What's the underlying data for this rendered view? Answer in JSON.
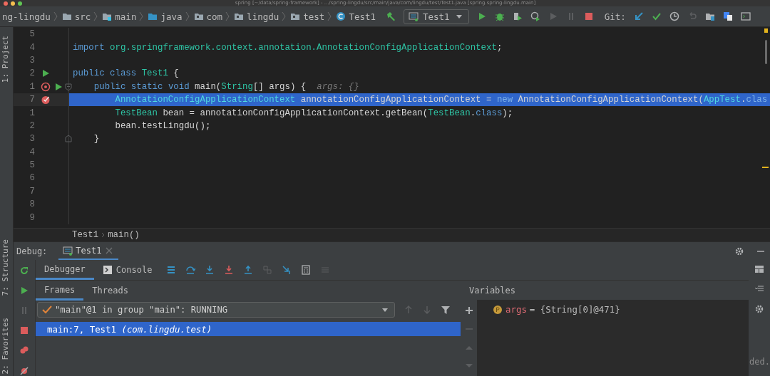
{
  "window": {
    "title": "spring [~/data/spring-framework] - .../spring-lingdu/src/main/java/com/lingdu/test/Test1.java [spring.spring-lingdu.main]"
  },
  "breadcrumbs": [
    {
      "label": "ng-lingdu",
      "kind": "module"
    },
    {
      "label": "src",
      "kind": "folder"
    },
    {
      "label": "main",
      "kind": "source-root"
    },
    {
      "label": "java",
      "kind": "java-root"
    },
    {
      "label": "com",
      "kind": "package"
    },
    {
      "label": "lingdu",
      "kind": "package"
    },
    {
      "label": "test",
      "kind": "package"
    },
    {
      "label": "Test1",
      "kind": "class"
    }
  ],
  "run_config": {
    "label": "Test1"
  },
  "toolbar": [
    {
      "kind": "run",
      "disabled": false
    },
    {
      "kind": "debug",
      "disabled": false
    },
    {
      "kind": "coverage",
      "disabled": false
    },
    {
      "kind": "profile",
      "disabled": false
    },
    {
      "kind": "resume",
      "disabled": true
    },
    {
      "kind": "pause",
      "disabled": true
    },
    {
      "kind": "stop",
      "disabled": false
    }
  ],
  "git": {
    "label": "Git:",
    "actions": [
      {
        "kind": "update",
        "disabled": false
      },
      {
        "kind": "commit",
        "disabled": false
      },
      {
        "kind": "history",
        "disabled": false
      },
      {
        "kind": "rollback",
        "disabled": true
      },
      {
        "kind": "structure",
        "disabled": false
      },
      {
        "kind": "translate",
        "disabled": false
      },
      {
        "kind": "terminal",
        "disabled": false
      }
    ]
  },
  "tool_tabs": [
    {
      "label": "1: Project",
      "kind": "top"
    },
    {
      "label": "7: Structure",
      "kind": "bottom"
    },
    {
      "label": "2: Favorites",
      "kind": "bottom"
    }
  ],
  "editor": {
    "lines": [
      {
        "number": "5",
        "current": false
      },
      {
        "number": "4",
        "kind": "top",
        "current": false,
        "tokens": [
          {
            "kind": "kw",
            "text": "import "
          },
          {
            "kind": "type",
            "text": "org.springframework.context.annotation.AnnotationConfigApplicationContext"
          },
          {
            "kind": "plain",
            "text": ";"
          }
        ]
      },
      {
        "number": "3",
        "current": false
      },
      {
        "number": "2",
        "kind": "top",
        "current": false,
        "markers": [
          {
            "kind": "run"
          }
        ],
        "tokens": [
          {
            "kind": "kw",
            "text": "public class "
          },
          {
            "kind": "type",
            "text": "Test1"
          },
          {
            "kind": "plain",
            "text": " {"
          }
        ]
      },
      {
        "number": "1",
        "kind": "member",
        "current": false,
        "markers": [
          {
            "kind": "method-breakpoint"
          },
          {
            "kind": "run"
          },
          {
            "kind": "fold-start"
          }
        ],
        "tokens": [
          {
            "kind": "kw",
            "text": "public static void"
          },
          {
            "kind": "plain",
            "text": " main("
          },
          {
            "kind": "type",
            "text": "String"
          },
          {
            "kind": "plain",
            "text": "[] args) {"
          },
          {
            "kind": "hint",
            "text": "args: {}"
          }
        ]
      },
      {
        "number": "7",
        "kind": "body",
        "current": true,
        "markers": [
          {
            "kind": "breakpoint"
          }
        ],
        "tokens": [
          {
            "kind": "type",
            "text": "AnnotationConfigApplicationContext"
          },
          {
            "kind": "plain",
            "text": " annotationConfigApplicationContext = "
          },
          {
            "kind": "kw",
            "text": "new"
          },
          {
            "kind": "plain",
            "text": " AnnotationConfigApplicationContext("
          },
          {
            "kind": "type",
            "text": "AppTest"
          },
          {
            "kind": "plain",
            "text": "."
          },
          {
            "kind": "kw",
            "text": "clas"
          }
        ]
      },
      {
        "number": "1",
        "kind": "body",
        "current": false,
        "tokens": [
          {
            "kind": "type",
            "text": "TestBean"
          },
          {
            "kind": "plain",
            "text": " bean = annotationConfigApplicationContext.getBean("
          },
          {
            "kind": "type",
            "text": "TestBean"
          },
          {
            "kind": "plain",
            "text": "."
          },
          {
            "kind": "kw",
            "text": "class"
          },
          {
            "kind": "plain",
            "text": ");"
          }
        ]
      },
      {
        "number": "2",
        "kind": "body",
        "current": false,
        "tokens": [
          {
            "kind": "plain",
            "text": "bean.testLingdu();"
          }
        ]
      },
      {
        "number": "3",
        "kind": "member",
        "current": false,
        "markers": [
          {
            "kind": "fold-end"
          }
        ],
        "tokens": [
          {
            "kind": "plain",
            "text": "}"
          }
        ]
      },
      {
        "number": "4",
        "current": false
      },
      {
        "number": "5",
        "current": false
      },
      {
        "number": "6",
        "current": false
      },
      {
        "number": "7",
        "current": false
      },
      {
        "number": "8",
        "current": false
      },
      {
        "number": "9",
        "current": false
      }
    ],
    "breadcrumb": [
      "Test1",
      "main()"
    ]
  },
  "debug": {
    "label": "Debug:",
    "session_tabs": [
      {
        "label": "Test1",
        "selected": true
      }
    ],
    "side_actions": [
      {
        "kind": "rerun",
        "disabled": false
      },
      {
        "kind": "resume",
        "disabled": false
      },
      {
        "kind": "pause",
        "disabled": true
      },
      {
        "kind": "stop",
        "disabled": false
      },
      {
        "kind": "breakpoints",
        "disabled": false
      },
      {
        "kind": "mute",
        "disabled": false
      }
    ],
    "tabs": [
      {
        "label": "Debugger",
        "kind": "debugger",
        "selected": true
      },
      {
        "label": "Console",
        "kind": "console",
        "selected": false
      }
    ],
    "step_actions": [
      {
        "kind": "menu",
        "disabled": false
      },
      {
        "kind": "step-over",
        "disabled": false
      },
      {
        "kind": "step-into",
        "disabled": false
      },
      {
        "kind": "force-step-into",
        "disabled": false
      },
      {
        "kind": "step-out",
        "disabled": false
      },
      {
        "kind": "drop-frame",
        "disabled": true
      },
      {
        "kind": "run-to-cursor",
        "disabled": false
      },
      {
        "kind": "evaluate",
        "disabled": false
      },
      {
        "kind": "trace",
        "disabled": true
      }
    ],
    "frames_tabs": [
      {
        "label": "Frames",
        "selected": true
      },
      {
        "label": "Threads",
        "selected": false
      }
    ],
    "thread": {
      "value": "\"main\"@1 in group \"main\": RUNNING"
    },
    "frames": [
      {
        "text": "main:7, Test1",
        "package": "(com.lingdu.test)",
        "selected": true
      }
    ],
    "variables": {
      "label": "Variables",
      "items": [
        {
          "name": "args",
          "value": "= {String[0]@471}"
        }
      ]
    },
    "overflow_text": "ded."
  }
}
